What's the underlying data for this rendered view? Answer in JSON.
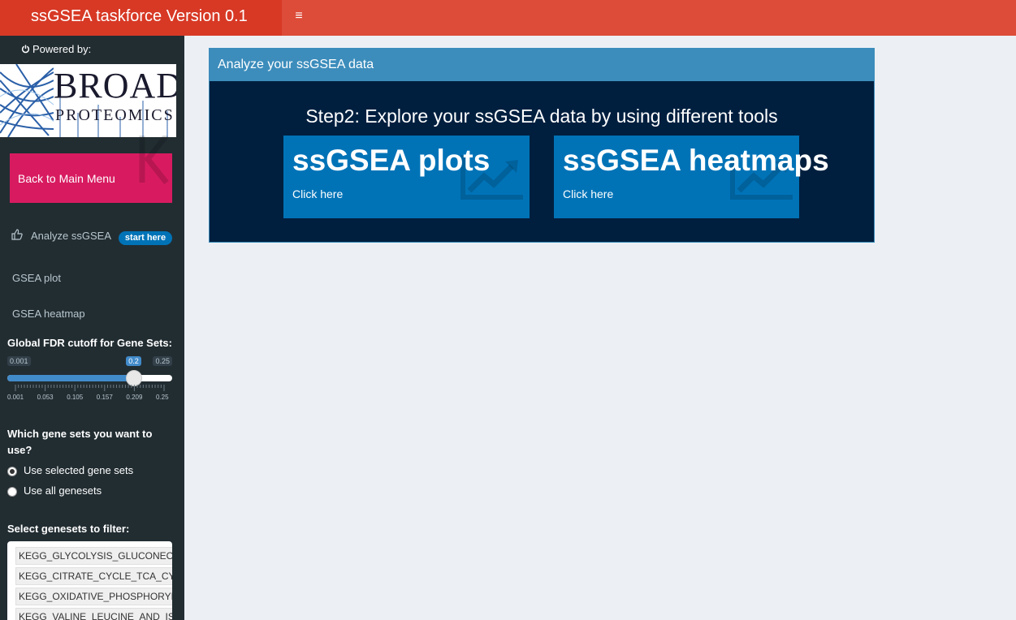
{
  "header": {
    "title": "ssGSEA taskforce Version 0.1",
    "toggle_icon": "hamburger-menu-icon"
  },
  "sidebar": {
    "powered_by": "Powered by:",
    "power_icon": "power-icon",
    "logo": {
      "line1": "BROAD",
      "line2": "PROTEOMICS"
    },
    "back_button": "Back to Main Menu",
    "menu": [
      {
        "label": "Analyze ssGSEA",
        "icon": "thumbs-up-icon",
        "badge": "start here"
      },
      {
        "label": "GSEA plot"
      },
      {
        "label": "GSEA heatmap"
      }
    ],
    "fdr": {
      "label": "Global FDR cutoff for Gene Sets:",
      "min": "0.001",
      "max": "0.25",
      "value": "0.2",
      "value_num": 0.2,
      "min_num": 0.001,
      "max_num": 0.25,
      "ticks": [
        "0.001",
        "0.053",
        "0.105",
        "0.157",
        "0.209",
        "0.25"
      ]
    },
    "gene_sets": {
      "label": "Which gene sets you want to use?",
      "options": [
        {
          "label": "Use selected gene sets",
          "checked": true
        },
        {
          "label": "Use all genesets",
          "checked": false
        }
      ]
    },
    "filter": {
      "label": "Select genesets to filter:",
      "items": [
        "KEGG_GLYCOLYSIS_GLUCONEOGENESIS",
        "KEGG_CITRATE_CYCLE_TCA_CYCLE",
        "KEGG_OXIDATIVE_PHOSPHORYLATION",
        "KEGG_VALINE_LEUCINE_AND_ISOLEUCINE_DEGRADATION"
      ]
    }
  },
  "main": {
    "box_title": "Analyze your ssGSEA data",
    "step_title": "Step2: Explore your ssGSEA data by using different tools",
    "value_boxes": [
      {
        "title": "ssGSEA plots",
        "subtitle": "Click here",
        "icon": "line-chart-icon"
      },
      {
        "title": "ssGSEA heatmaps",
        "subtitle": "Click here",
        "icon": "line-chart-icon"
      }
    ]
  },
  "colors": {
    "header": "#dd4b39",
    "sidebar": "#222d32",
    "back_button": "#d81b60",
    "box_bg": "#001f3f",
    "box_header": "#3c8dbc",
    "value_box": "#0073b7"
  }
}
